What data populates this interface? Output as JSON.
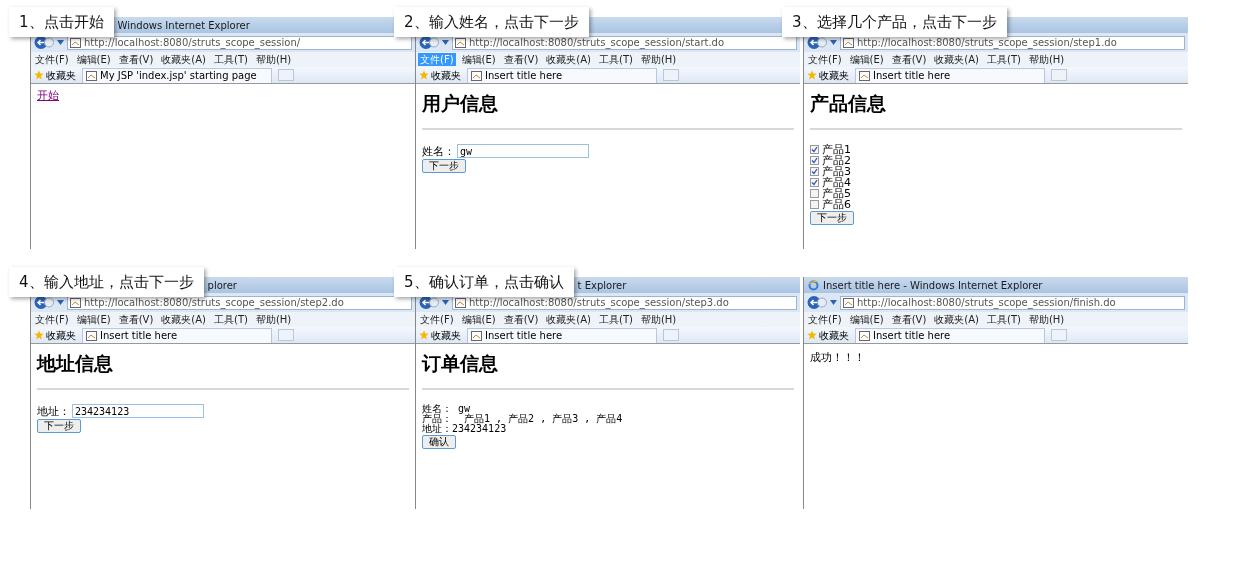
{
  "steps": [
    {
      "caption": "1、点击开始",
      "window": {
        "title": "Windows Internet Explorer",
        "logo": false,
        "address": "http://localhost:8080/struts_scope_session/",
        "menu": [
          {
            "label": "文件(F)",
            "selected": false
          },
          {
            "label": "编辑(E)",
            "selected": false
          },
          {
            "label": "查看(V)",
            "selected": false
          },
          {
            "label": "收藏夹(A)",
            "selected": false
          },
          {
            "label": "工具(T)",
            "selected": false
          },
          {
            "label": "帮助(H)",
            "selected": false
          }
        ],
        "favorites": "收藏夹",
        "tab": "My JSP 'index.jsp' starting page"
      },
      "content": [
        {
          "kind": "link",
          "text": "开始"
        }
      ]
    },
    {
      "caption": "2、输入姓名，点击下一步",
      "window": {
        "logo": false,
        "address": "http://localhost:8080/struts_scope_session/start.do",
        "menu": [
          {
            "label": "文件(F)",
            "selected": true
          },
          {
            "label": "编辑(E)",
            "selected": false
          },
          {
            "label": "查看(V)",
            "selected": false
          },
          {
            "label": "收藏夹(A)",
            "selected": false
          },
          {
            "label": "工具(T)",
            "selected": false
          },
          {
            "label": "帮助(H)",
            "selected": false
          }
        ],
        "favorites": "收藏夹",
        "tab": "Insert title here"
      },
      "content": [
        {
          "kind": "heading",
          "text": "用户信息"
        },
        {
          "kind": "field",
          "label": "姓名：",
          "value": "gw"
        },
        {
          "kind": "button",
          "text": "下一步"
        }
      ]
    },
    {
      "caption": "3、选择几个产品，点击下一步",
      "window": {
        "logo": false,
        "address": "http://localhost:8080/struts_scope_session/step1.do",
        "menu": [
          {
            "label": "文件(F)",
            "selected": false
          },
          {
            "label": "编辑(E)",
            "selected": false
          },
          {
            "label": "查看(V)",
            "selected": false
          },
          {
            "label": "收藏夹(A)",
            "selected": false
          },
          {
            "label": "工具(T)",
            "selected": false
          },
          {
            "label": "帮助(H)",
            "selected": false
          }
        ],
        "favorites": "收藏夹",
        "tab": "Insert title here"
      },
      "content": [
        {
          "kind": "heading",
          "text": "产品信息"
        },
        {
          "kind": "checkbox",
          "text": "产品1",
          "checked": true
        },
        {
          "kind": "checkbox",
          "text": "产品2",
          "checked": true
        },
        {
          "kind": "checkbox",
          "text": "产品3",
          "checked": true
        },
        {
          "kind": "checkbox",
          "text": "产品4",
          "checked": true
        },
        {
          "kind": "checkbox",
          "text": "产品5",
          "checked": false
        },
        {
          "kind": "checkbox",
          "text": "产品6",
          "checked": false
        },
        {
          "kind": "button",
          "text": "下一步"
        }
      ]
    },
    {
      "caption": "4、输入地址，点击下一步",
      "window": {
        "title": "plorer",
        "logo": false,
        "address": "http://localhost:8080/struts_scope_session/step2.do",
        "menu": [
          {
            "label": "文件(F)",
            "selected": false
          },
          {
            "label": "编辑(E)",
            "selected": false
          },
          {
            "label": "查看(V)",
            "selected": false
          },
          {
            "label": "收藏夹(A)",
            "selected": false
          },
          {
            "label": "工具(T)",
            "selected": false
          },
          {
            "label": "帮助(H)",
            "selected": false
          }
        ],
        "favorites": "收藏夹",
        "tab": "Insert title here"
      },
      "content": [
        {
          "kind": "heading",
          "text": "地址信息"
        },
        {
          "kind": "field",
          "label": "地址：",
          "value": "234234123"
        },
        {
          "kind": "button",
          "text": "下一步"
        }
      ]
    },
    {
      "caption": "5、确认订单，点击确认",
      "window": {
        "title": "t Explorer",
        "logo": false,
        "address": "http://localhost:8080/struts_scope_session/step3.do",
        "menu": [
          {
            "label": "文件(F)",
            "selected": false
          },
          {
            "label": "编辑(E)",
            "selected": false
          },
          {
            "label": "查看(V)",
            "selected": false
          },
          {
            "label": "收藏夹(A)",
            "selected": false
          },
          {
            "label": "工具(T)",
            "selected": false
          },
          {
            "label": "帮助(H)",
            "selected": false
          }
        ],
        "favorites": "收藏夹",
        "tab": "Insert title here"
      },
      "content": [
        {
          "kind": "heading",
          "text": "订单信息"
        },
        {
          "kind": "line",
          "text": "姓名： gw"
        },
        {
          "kind": "line",
          "text": "产品：  产品1 , 产品2 , 产品3 , 产品4"
        },
        {
          "kind": "line",
          "text": "地址：234234123"
        },
        {
          "kind": "button",
          "text": "确认"
        }
      ]
    },
    {
      "window": {
        "title": "Insert title here - Windows Internet Explorer",
        "logo": true,
        "address": "http://localhost:8080/struts_scope_session/finish.do",
        "menu": [
          {
            "label": "文件(F)",
            "selected": false
          },
          {
            "label": "编辑(E)",
            "selected": false
          },
          {
            "label": "查看(V)",
            "selected": false
          },
          {
            "label": "收藏夹(A)",
            "selected": false
          },
          {
            "label": "工具(T)",
            "selected": false
          },
          {
            "label": "帮助(H)",
            "selected": false
          }
        ],
        "favorites": "收藏夹",
        "tab": "Insert title here"
      },
      "content": [
        {
          "kind": "text",
          "text": "成功！！！"
        }
      ]
    }
  ]
}
